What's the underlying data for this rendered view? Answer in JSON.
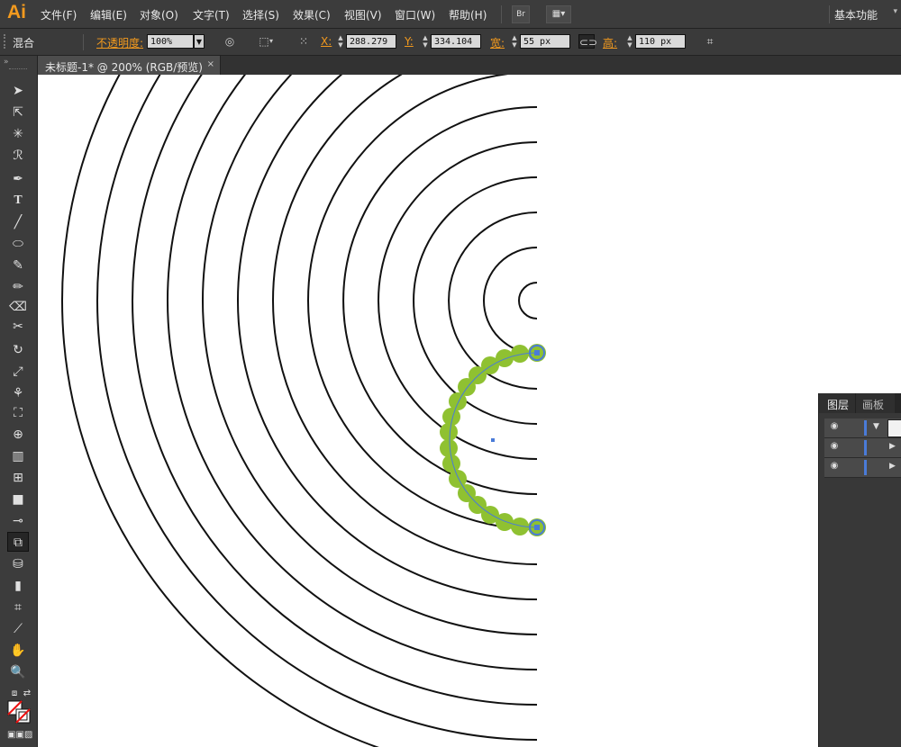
{
  "app": {
    "logo": "Ai"
  },
  "menu": [
    "文件(F)",
    "编辑(E)",
    "对象(O)",
    "文字(T)",
    "选择(S)",
    "效果(C)",
    "视图(V)",
    "窗口(W)",
    "帮助(H)"
  ],
  "bridge_label": "Br",
  "workspace": "基本功能",
  "control": {
    "mode_label": "混合",
    "opacity_label": "不透明度:",
    "opacity_value": "100%",
    "x_label": "X:",
    "x_value": "288.279",
    "y_label": "Y:",
    "y_value": "334.104",
    "w_label": "宽:",
    "w_value": "55 px",
    "h_label": "高:",
    "h_value": "110 px"
  },
  "document_tab": {
    "title": "未标题-1* @ 200% (RGB/预览)",
    "close": "×"
  },
  "layers_panel": {
    "tabs": [
      "图层",
      "画板"
    ],
    "rows": 3
  },
  "colors": {
    "accent": "#f39a1e",
    "brush_green": "#8fc131",
    "selection_blue": "#4a7bd8",
    "stroke": "#111111"
  }
}
